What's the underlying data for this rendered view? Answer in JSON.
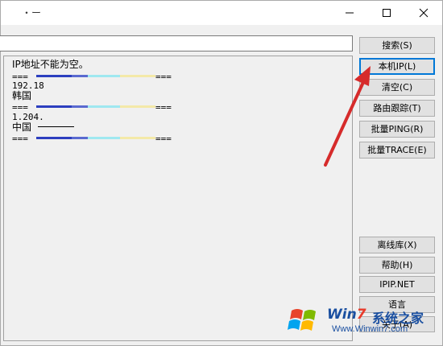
{
  "window": {
    "title": "・ー"
  },
  "input": {
    "value": "",
    "placeholder": ""
  },
  "output": {
    "lines": {
      "msg": "IP地址不能为空。",
      "ip1": "192.18",
      "country1": "韩国",
      "ip2": "1.204.",
      "country2": "中国",
      "sep_prefix": "===",
      "sep_suffix": "==="
    }
  },
  "buttons": {
    "search": "搜索(S)",
    "local_ip": "本机IP(L)",
    "clear": "清空(C)",
    "traceroute": "路由跟踪(T)",
    "batch_ping": "批量PING(R)",
    "batch_trace": "批量TRACE(E)",
    "offline_db": "离线库(X)",
    "help": "帮助(H)",
    "ipip": "IPIP.NET",
    "language": "语言",
    "about": "关于(A)"
  },
  "watermark": {
    "brand_win": "Win",
    "brand_seven": "7",
    "brand_cn": "系统之家",
    "url": "Www.Winwin7.com"
  },
  "colors": {
    "accent": "#0078d7",
    "arrow": "#d62b2b",
    "sep_blue": "#2c3fbf",
    "sep_cyan": "#9fe8f0",
    "sep_yellow": "#f4e9a8"
  }
}
